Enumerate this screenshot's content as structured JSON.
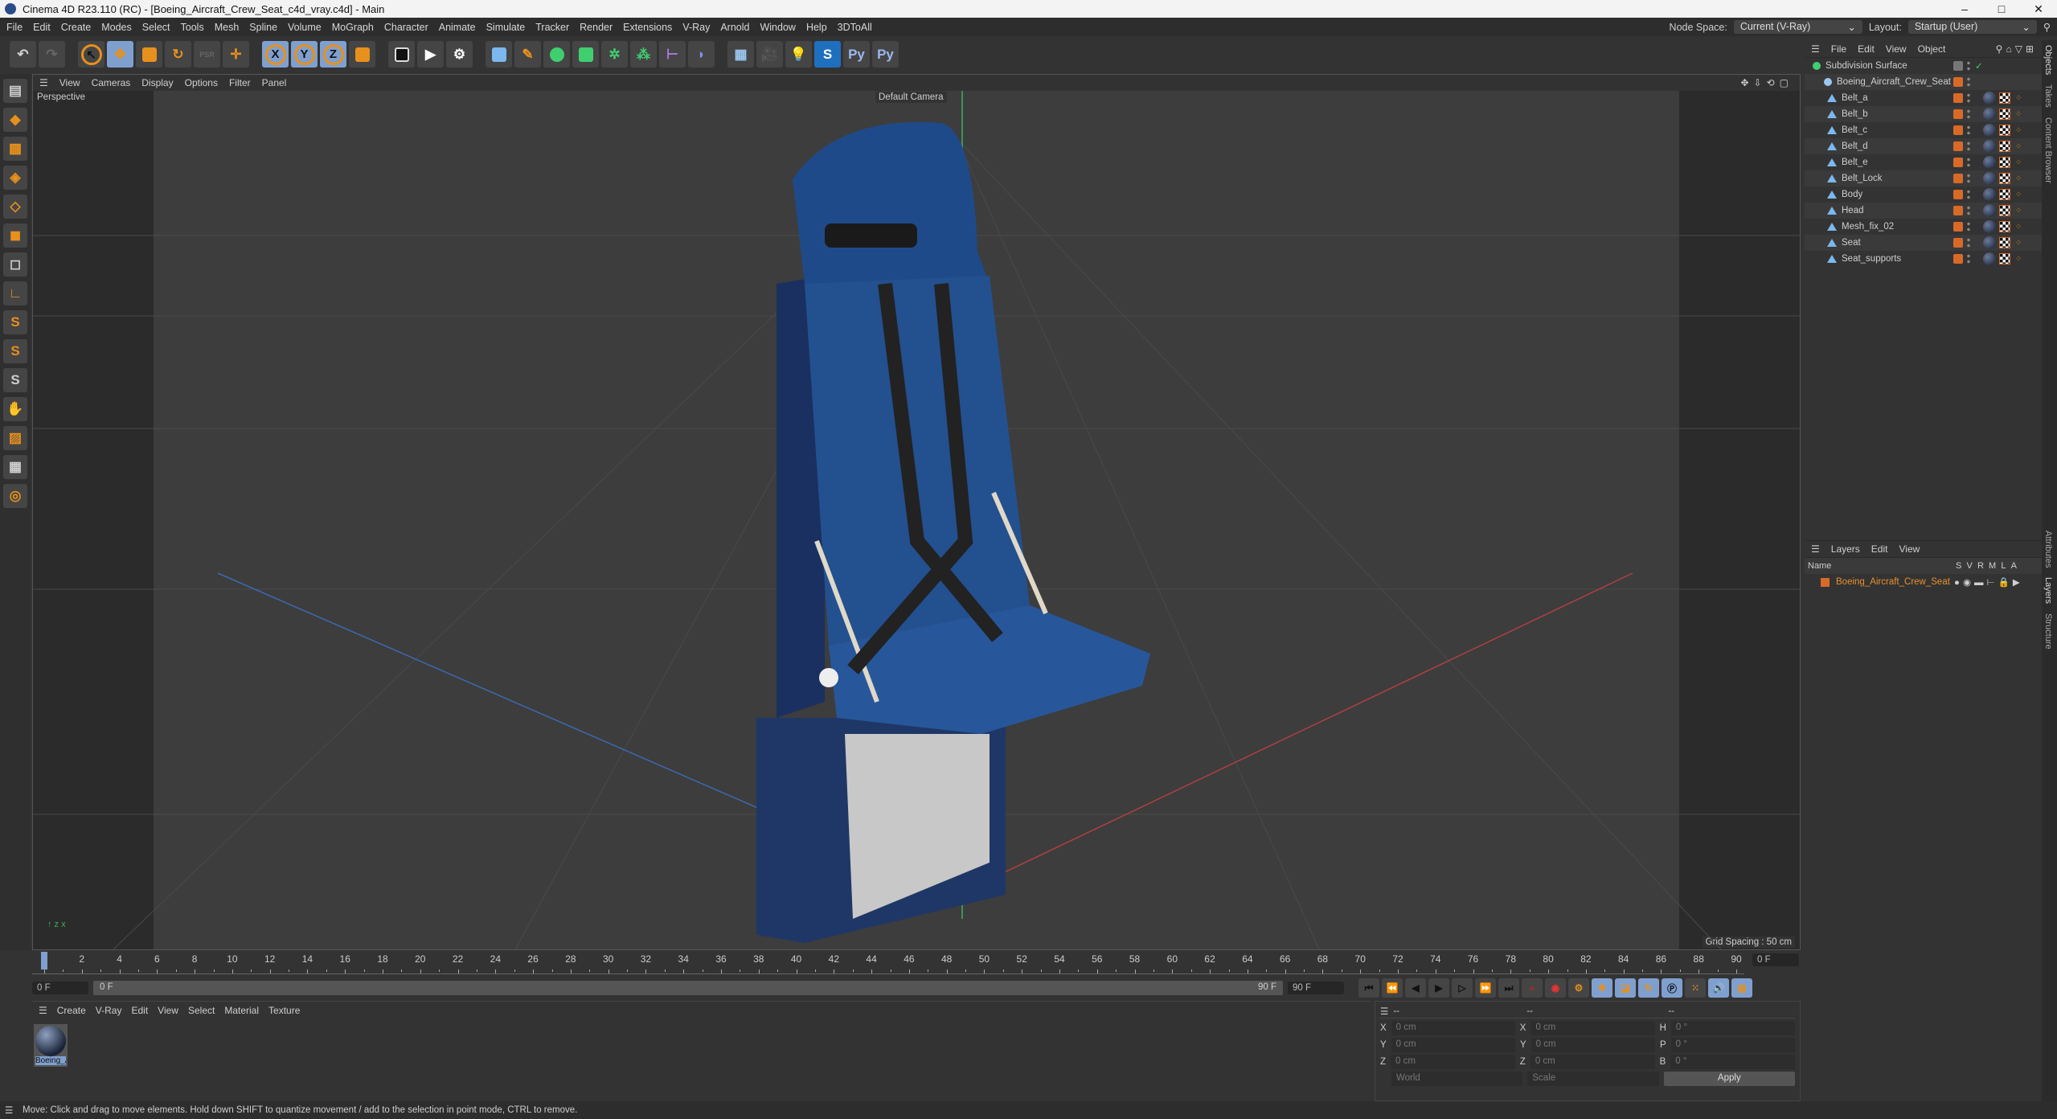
{
  "window": {
    "title": "Cinema 4D R23.110 (RC) - [Boeing_Aircraft_Crew_Seat_c4d_vray.c4d] - Main",
    "controls": [
      "–",
      "□",
      "✕"
    ]
  },
  "menu": [
    "File",
    "Edit",
    "Create",
    "Modes",
    "Select",
    "Tools",
    "Mesh",
    "Spline",
    "Volume",
    "MoGraph",
    "Character",
    "Animate",
    "Simulate",
    "Tracker",
    "Render",
    "Extensions",
    "V-Ray",
    "Arnold",
    "Window",
    "Help",
    "3DToAll"
  ],
  "nodespace": {
    "label": "Node Space:",
    "value": "Current (V-Ray)",
    "layout_label": "Layout:",
    "layout_value": "Startup (User)"
  },
  "toolbar": {
    "axes": [
      "X",
      "Y",
      "Z"
    ]
  },
  "viewport": {
    "menu": [
      "View",
      "Cameras",
      "Display",
      "Options",
      "Filter",
      "Panel"
    ],
    "view_name": "Perspective",
    "camera": "Default Camera",
    "grid_spacing": "Grid Spacing : 50 cm"
  },
  "objects": {
    "menu": [
      "File",
      "Edit",
      "View",
      "Object"
    ],
    "root": "Subdivision Surface",
    "group": "Boeing_Aircraft_Crew_Seat",
    "children": [
      "Belt_a",
      "Belt_b",
      "Belt_c",
      "Belt_d",
      "Belt_e",
      "Belt_Lock",
      "Body",
      "Head",
      "Mesh_fix_02",
      "Seat",
      "Seat_supports"
    ]
  },
  "layers": {
    "menu": [
      "Layers",
      "Edit",
      "View"
    ],
    "columns": [
      "Name",
      "S",
      "V",
      "R",
      "M",
      "L",
      "A"
    ],
    "items": [
      {
        "name": "Boeing_Aircraft_Crew_Seat",
        "color": "#d86a28"
      }
    ]
  },
  "side_tabs": [
    "Objects",
    "Takes",
    "Content Browser",
    "Attributes",
    "Layers",
    "Structure"
  ],
  "timeline": {
    "start": 0,
    "end": 90,
    "step": 2,
    "current": "0 F",
    "range_start": "0 F",
    "range_label": "0 F",
    "range_end": "90 F",
    "end_field": "90 F",
    "right_field": "0 F"
  },
  "materials": {
    "menu": [
      "Create",
      "V-Ray",
      "Edit",
      "View",
      "Select",
      "Material",
      "Texture"
    ],
    "items": [
      "Boeing_A"
    ]
  },
  "coords": {
    "headers": [
      "--",
      "--",
      "--"
    ],
    "rows": [
      [
        "X",
        "0 cm",
        "X",
        "0 cm",
        "H",
        "0 °"
      ],
      [
        "Y",
        "0 cm",
        "Y",
        "0 cm",
        "P",
        "0 °"
      ],
      [
        "Z",
        "0 cm",
        "Z",
        "0 cm",
        "B",
        "0 °"
      ]
    ],
    "mode": "World",
    "scale": "Scale",
    "apply": "Apply"
  },
  "status": "Move: Click and drag to move elements. Hold down SHIFT to quantize movement / add to the selection in point mode, CTRL to remove.",
  "colors": {
    "accent": "#7fa0cf",
    "orange": "#e8901c",
    "tag": "#d86a28",
    "seat": "#1f4a8a"
  }
}
